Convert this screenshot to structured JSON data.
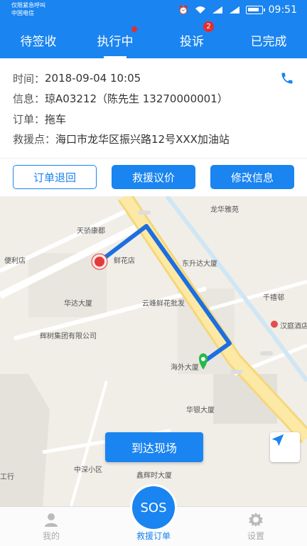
{
  "status_bar": {
    "carrier_line1": "仅限紧急呼叫",
    "carrier_line2": "中国电信",
    "time": "09:51"
  },
  "tabs": [
    {
      "label": "待签收"
    },
    {
      "label": "执行中"
    },
    {
      "label": "投诉",
      "badge": "2"
    },
    {
      "label": "已完成"
    }
  ],
  "order": {
    "time_label": "时间：",
    "time_value": "2018-09-04  10:05",
    "info_label": "信息：",
    "info_value": "琼A03212（陈先生  13270000001）",
    "order_label": "订单：",
    "order_value": "拖车",
    "rescue_label": "救援点：",
    "rescue_value": "海口市龙华区振兴路12号XXX加油站"
  },
  "actions": {
    "return": "订单退回",
    "price": "救援议价",
    "modify": "修改信息"
  },
  "map": {
    "labels": [
      "天骄康都",
      "龙华雅苑",
      "东升达大厦",
      "鲜花店",
      "华达大厦",
      "云峰鲜花批发",
      "千禧邨",
      "汉庭酒店",
      "辉树集团有限公司",
      "海外大厦",
      "华银大厦",
      "中深小区",
      "鑫辉时大厦",
      "便利店",
      "工行"
    ],
    "arrive_label": "到达现场"
  },
  "bottom_nav": {
    "mine": "我的",
    "rescue": "救援订单",
    "settings": "设置",
    "sos": "SOS"
  }
}
